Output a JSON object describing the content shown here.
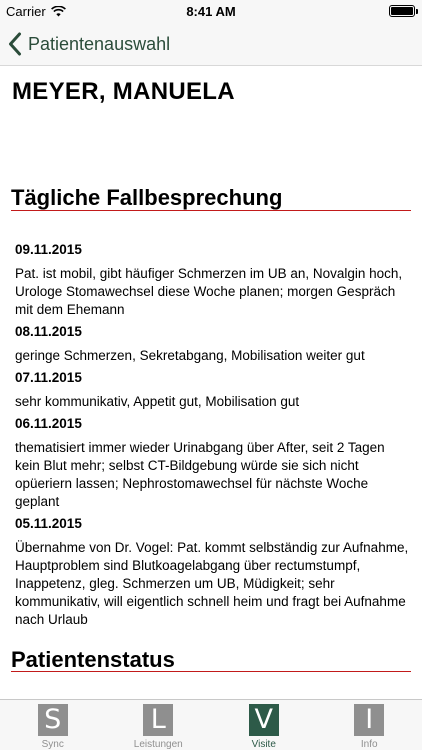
{
  "status_bar": {
    "carrier": "Carrier",
    "time": "8:41 AM",
    "icons": [
      "wifi-icon",
      "battery-icon"
    ]
  },
  "nav": {
    "back_label": "Patientenauswahl",
    "back_icon": "chevron-left-icon"
  },
  "patient": {
    "name": "MEYER, MANUELA"
  },
  "sections": {
    "daily": "Tägliche Fallbesprechung",
    "status": "Patientenstatus"
  },
  "entries": [
    {
      "date": "09.11.2015",
      "text": "Pat. ist mobil, gibt häufiger Schmerzen im UB an, Novalgin hoch, Urologe Stomawechsel diese Woche planen; morgen Gespräch mit dem Ehemann"
    },
    {
      "date": "08.11.2015",
      "text": "geringe Schmerzen, Sekretabgang, Mobilisation weiter gut"
    },
    {
      "date": "07.11.2015",
      "text": "sehr kommunikativ, Appetit gut, Mobilisation gut"
    },
    {
      "date": "06.11.2015",
      "text": "thematisiert immer wieder Urinabgang über After, seit 2 Tagen kein Blut mehr; selbst CT-Bildgebung würde sie sich nicht opüeriern lassen; Nephrostomawechsel für nächste Woche geplant"
    },
    {
      "date": "05.11.2015",
      "text": "Übernahme von Dr. Vogel: Pat. kommt selbständig zur Aufnahme, Hauptproblem sind Blutkoagelabgang über rectumstumpf, Inappetenz, gleg. Schmerzen um UB, Müdigkeit; sehr kommunikativ, will eigentlich schnell heim und fragt bei Aufnahme nach Urlaub"
    }
  ],
  "tabs": [
    {
      "letter": "S",
      "label": "Sync"
    },
    {
      "letter": "L",
      "label": "Leistungen"
    },
    {
      "letter": "V",
      "label": "Visite"
    },
    {
      "letter": "I",
      "label": "Info"
    }
  ],
  "colors": {
    "accent": "#2d5a48",
    "section_rule": "#c21a1a",
    "inactive": "#8f8f8f"
  }
}
